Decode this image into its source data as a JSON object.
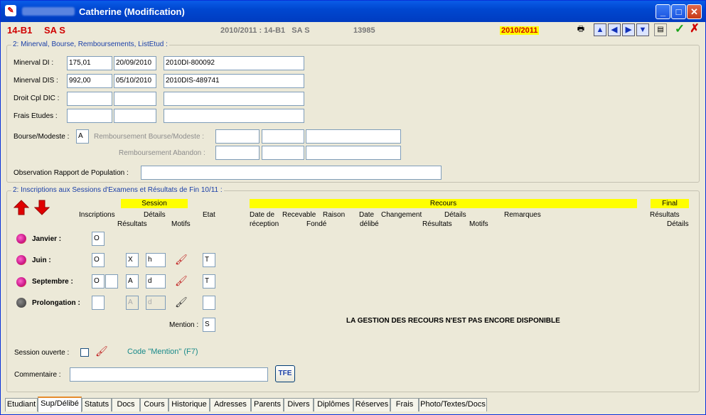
{
  "window": {
    "title_suffix": "Catherine (Modification)",
    "min_label": "_",
    "max_label": "□",
    "close_label": "✕",
    "app_icon": "app-icon"
  },
  "header": {
    "code": "14-B1",
    "section": "SA S",
    "info": "2010/2011 : 14-B1   SA S",
    "number": "13985",
    "year_badge": "2010/2011",
    "tools": {
      "print": "printer-icon",
      "first": "▲",
      "prev": "◀",
      "next": "▶",
      "last": "▼",
      "notes": "notes-icon",
      "ok": "✓",
      "cancel": "✗"
    }
  },
  "minerval": {
    "group_title": "2: Minerval, Bourse, Remboursements, ListEtud :",
    "rows": [
      {
        "label": "Minerval DI :",
        "amount": "175,01",
        "date": "20/09/2010",
        "ref": "2010DI-800092"
      },
      {
        "label": "Minerval DIS :",
        "amount": "992,00",
        "date": "05/10/2010",
        "ref": "2010DIS-489741"
      },
      {
        "label": "Droit Cpl DIC :",
        "amount": "",
        "date": "",
        "ref": ""
      },
      {
        "label": "Frais Etudes :",
        "amount": "",
        "date": "",
        "ref": ""
      }
    ],
    "bourse_label": "Bourse/Modeste :",
    "bourse_value": "A",
    "rb_bourse_label": "Remboursement Bourse/Modeste :",
    "rb_abandon_label": "Remboursement Abandon :",
    "observation_label": "Observation Rapport de Population :",
    "observation_value": ""
  },
  "inscriptions": {
    "group_title": "2: Inscriptions aux Sessions d'Examens et Résultats de Fin 10/11 :",
    "session_header": "Session",
    "recours_header": "Recours",
    "final_header": "Final",
    "cols": {
      "inscriptions": "Inscriptions",
      "details": "Détails",
      "etat": "Etat",
      "resultats": "Résultats",
      "motifs": "Motifs",
      "date_de": "Date de",
      "reception": "réception",
      "recevable": "Recevable",
      "fonde": "Fondé",
      "raison": "Raison",
      "date": "Date",
      "delibe": "délibé",
      "changement": "Changement",
      "r_resultats": "Résultats",
      "r_details": "Détails",
      "r_motifs": "Motifs",
      "remarques": "Remarques",
      "f_resultats": "Résultats",
      "f_details": "Détails"
    },
    "sessions": [
      {
        "name": "Janvier :",
        "insc": "O",
        "insc2": null,
        "res": null,
        "mot": null,
        "etat": null
      },
      {
        "name": "Juin :",
        "insc": "O",
        "insc2": null,
        "res": "X",
        "mot": "h",
        "etat": "T"
      },
      {
        "name": "Septembre :",
        "insc": "O",
        "insc2": "",
        "res": "A",
        "mot": "d",
        "etat": "T"
      },
      {
        "name": "Prolongation :",
        "insc": "",
        "insc2": null,
        "res": "A",
        "mot": "d",
        "etat": ""
      }
    ],
    "mention_label": "Mention :",
    "mention_value": "S",
    "recours_notice": "LA GESTION DES RECOURS N'EST PAS ENCORE DISPONIBLE",
    "session_ouverte_label": "Session ouverte :",
    "code_mention": "Code \"Mention\" (F7)",
    "commentaire_label": "Commentaire :",
    "commentaire_value": "",
    "tfe_label": "TFE"
  },
  "tabs": [
    "Etudiant",
    "Sup/Délibé",
    "Statuts",
    "Docs",
    "Cours",
    "Historique",
    "Adresses",
    "Parents",
    "Divers",
    "Diplômes",
    "Réserves",
    "Frais",
    "Photo/Textes/Docs"
  ],
  "active_tab": "Sup/Délibé",
  "colors": {
    "title_blue": "#0047d0",
    "red": "#d00000",
    "yellow": "#ffff00",
    "group_blue": "#1a3fa8",
    "teal": "#198a8a"
  }
}
